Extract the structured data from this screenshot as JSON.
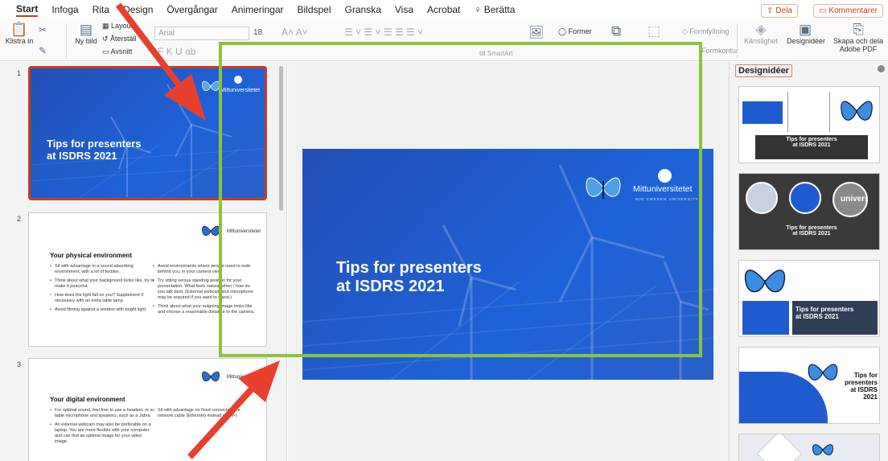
{
  "ribbon": {
    "tabs": [
      "Start",
      "Infoga",
      "Rita",
      "Design",
      "Övergångar",
      "Animeringar",
      "Bildspel",
      "Granska",
      "Visa",
      "Acrobat"
    ],
    "tell_me": "Berätta",
    "share_label": "Dela",
    "comments_label": "Kommentarer"
  },
  "toolbar": {
    "paste_label": "Klistra in",
    "new_slide_label": "Ny bild",
    "layout_label": "Layout",
    "reset_label": "Återställ",
    "section_label": "Avsnitt",
    "font_name": "Arial",
    "font_size": "18",
    "smartart_label": "till SmartArt",
    "shapes_label": "Former",
    "fill_label": "Formfyllning",
    "outline_label": "Formkontur",
    "sensitivity_label": "Känslighet",
    "designer_label": "Designidéer",
    "adobe_label_1": "Skapa och dela",
    "adobe_label_2": "Adobe PDF"
  },
  "slides": [
    {
      "number": "1",
      "title_line1": "Tips for presenters",
      "title_line2": "at ISDRS 2021",
      "logo_text": "Mittuniversitetet"
    },
    {
      "number": "2",
      "heading": "Your physical environment",
      "logo_text": "Mittuniversitetet",
      "left_bullets": [
        "Sit with advantage in a sound-absorbing environment, with a lot of textiles",
        "Think about what your background looks like, try to make it peaceful.",
        "How does the light fall on you? Supplement if necessary with an extra table lamp.",
        "Avoid filming against a window with bright light."
      ],
      "right_bullets": [
        "Avoid environments where people need to walk behind you, in your camera view.",
        "Try sitting versus standing position for your presentation. What feels natural when / how do you talk best. (External webcam and microphone may be required if you want to stand.)",
        "Think about what your outgoing image looks like and choose a reasonable distance to the camera."
      ]
    },
    {
      "number": "3",
      "heading": "Your digital environment",
      "logo_text": "Mittuniversitetet",
      "left_bullets": [
        "For optimal sound, feel free to use a headset, or a table microphone and speakers, such as a Jabra",
        "An external webcam may also be preferable on a laptop. You are more flexible with your computer and can find an optimal image for your video image."
      ],
      "right_bullets": [
        "Sit with advantage on fixed connection, i.e. network cable (Ethernet) instead of WiFi."
      ]
    }
  ],
  "main_slide": {
    "title_line1": "Tips for presenters",
    "title_line2": "at ISDRS 2021",
    "logo_text": "Mittuniversitetet",
    "logo_sub": "MID SWEDEN UNIVERSITY"
  },
  "design_ideas": {
    "header": "Designidéer",
    "idea1_line1": "Tips for presenters",
    "idea1_line2": "at ISDRS 2021",
    "idea2_line1": "Tips for presenters",
    "idea2_line2": "at ISDRS 2021",
    "idea2_watermark": "universi",
    "idea3_line1": "Tips for presenters",
    "idea3_line2": "at ISDRS 2021",
    "idea4_line1": "Tips for",
    "idea4_line2": "presenters",
    "idea4_line3": "at ISDRS",
    "idea4_line4": "2021"
  },
  "colors": {
    "accent": "#c43e1c",
    "slide_blue": "#1f5bd0",
    "annotation_green": "#8cc33b",
    "annotation_red": "#e8402f"
  }
}
